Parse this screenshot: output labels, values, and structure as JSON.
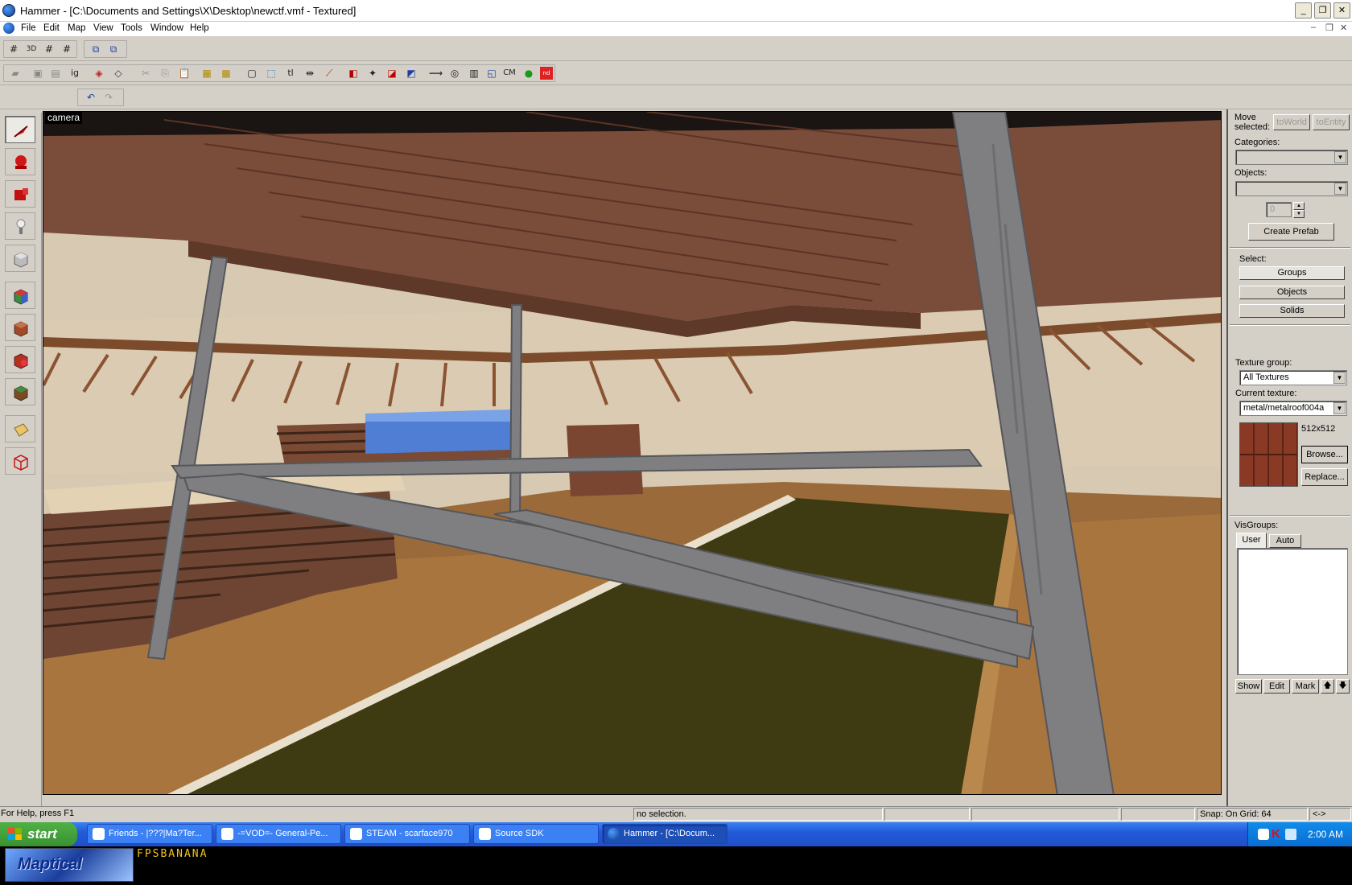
{
  "window": {
    "title": "Hammer - [C:\\Documents and Settings\\X\\Desktop\\newctf.vmf - Textured]",
    "caption_buttons": [
      "_",
      "❐",
      "✕"
    ],
    "mdi_buttons": [
      "–",
      "❐",
      "✕"
    ]
  },
  "menu": [
    "File",
    "Edit",
    "Map",
    "View",
    "Tools",
    "Window",
    "Help"
  ],
  "toolbar": {
    "grid_labels": [
      "#",
      "3D",
      "#",
      "#"
    ],
    "text_buttons": [
      "ig",
      "tl",
      "CM"
    ]
  },
  "left_tools": [
    "selection-tool",
    "magnify-tool",
    "camera-tool",
    "entity-tool",
    "block-tool",
    "texture-application-tool",
    "apply-current-texture-tool",
    "decal-tool",
    "overlay-tool",
    "clipping-tool",
    "vertex-tool"
  ],
  "viewport": {
    "label": "camera"
  },
  "right_panel": {
    "move_selected_label": "Move selected:",
    "to_world": "toWorld",
    "to_entity": "toEntity",
    "categories_label": "Categories:",
    "objects_label": "Objects:",
    "spinner_value": "0",
    "create_prefab": "Create Prefab",
    "select_label": "Select:",
    "select_buttons": [
      "Groups",
      "Objects",
      "Solids"
    ],
    "texture_group_label": "Texture group:",
    "texture_group_value": "All Textures",
    "current_texture_label": "Current texture:",
    "current_texture_value": "metal/metalroof004a",
    "texture_size": "512x512",
    "browse": "Browse...",
    "replace": "Replace...",
    "visgroups_label": "VisGroups:",
    "visgroup_tabs": [
      "User",
      "Auto"
    ],
    "visgroup_buttons": [
      "Show",
      "Edit",
      "Mark",
      "🡅",
      "🡇"
    ]
  },
  "statusbar": {
    "help": "For Help, press F1",
    "selection": "no selection.",
    "snap": "Snap: On Grid: 64",
    "extra": "<->"
  },
  "taskbar": {
    "start": "start",
    "tasks": [
      "Friends - |???|Ma?Ter...",
      "-=VOD=- General-Pe...",
      "STEAM - scarface970",
      "Source SDK",
      "Hammer - [C:\\Docum..."
    ],
    "clock": "2:00 AM"
  },
  "banner": {
    "logo_text": "Maptical",
    "site_text": "FPSBANANA"
  },
  "colors": {
    "titlebar": "#ffffff",
    "face": "#d4d0c8",
    "taskbar_blue": "#225bd9",
    "start_green": "#389130",
    "wood": "#7a4a35",
    "wall": "#d9c9b0",
    "floor": "#a8753f",
    "water": "#3e3a12",
    "metal": "#7f7f82"
  }
}
